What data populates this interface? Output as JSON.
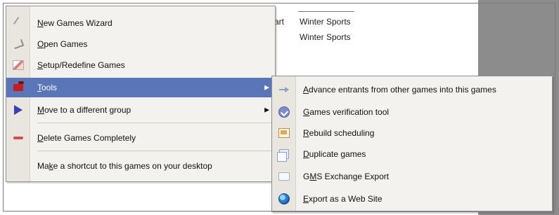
{
  "background_list": {
    "fragment": "art",
    "items": [
      "Winter Sports",
      "Winter Sports"
    ]
  },
  "menu": {
    "items": [
      {
        "label_pre": "",
        "label_u": "N",
        "label_post": "ew Games Wizard",
        "icon": "wand-icon"
      },
      {
        "label_pre": "",
        "label_u": "O",
        "label_post": "pen Games",
        "icon": "open-icon"
      },
      {
        "label_pre": "",
        "label_u": "S",
        "label_post": "etup/Redefine Games",
        "icon": "setup-icon"
      },
      {
        "label_pre": "",
        "label_u": "T",
        "label_post": "ools",
        "icon": "tools-icon",
        "has_submenu": true,
        "selected": true
      },
      {
        "label_pre": "",
        "label_u": "M",
        "label_post": "ove to a different group",
        "icon": "move-icon",
        "has_submenu": true
      },
      {
        "label_pre": "",
        "label_u": "D",
        "label_post": "elete Games Completely",
        "icon": "delete-icon"
      },
      {
        "label_pre": "Ma",
        "label_u": "k",
        "label_post": "e a shortcut to this games on your desktop",
        "icon": ""
      }
    ]
  },
  "submenu": {
    "items": [
      {
        "label_pre": "",
        "label_u": "A",
        "label_post": "dvance entrants from other games into this games",
        "icon": "arrow-right-icon"
      },
      {
        "label_pre": "",
        "label_u": "G",
        "label_post": "ames verification tool",
        "icon": "verify-icon"
      },
      {
        "label_pre": "",
        "label_u": "R",
        "label_post": "ebuild scheduling",
        "icon": "rebuild-icon"
      },
      {
        "label_pre": "",
        "label_u": "D",
        "label_post": "uplicate games",
        "icon": "duplicate-icon"
      },
      {
        "label_pre": "G",
        "label_u": "M",
        "label_post": "S Exchange Export",
        "icon": "export-icon"
      },
      {
        "label_pre": "",
        "label_u": "E",
        "label_post": "xport as a Web Site",
        "icon": "web-icon"
      }
    ]
  },
  "colors": {
    "selected_bg": "#5a76b8",
    "menu_bg": "#f4f2ee",
    "gutter_bg": "#e9e6df",
    "right_panel_gray": "#8c8c8c"
  }
}
